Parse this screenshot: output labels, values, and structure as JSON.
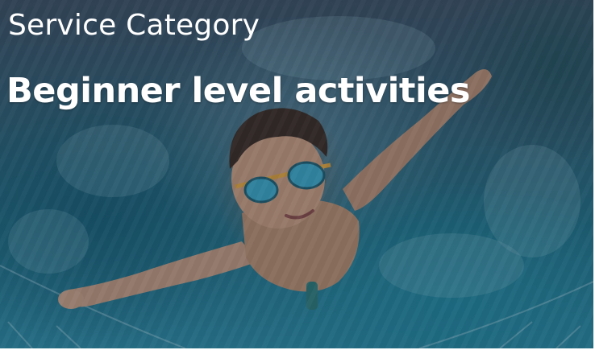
{
  "card": {
    "category": "Service Category",
    "title": "Beginner level activities",
    "image_subject": "swimmer-photo"
  },
  "colors": {
    "text": "#ffffff",
    "water_dark": "#1f6f86",
    "water_light": "#2a89a4",
    "skin": "#c89a7c",
    "goggles": "#3aa7c8",
    "goggle_strap": "#e0a23a"
  }
}
